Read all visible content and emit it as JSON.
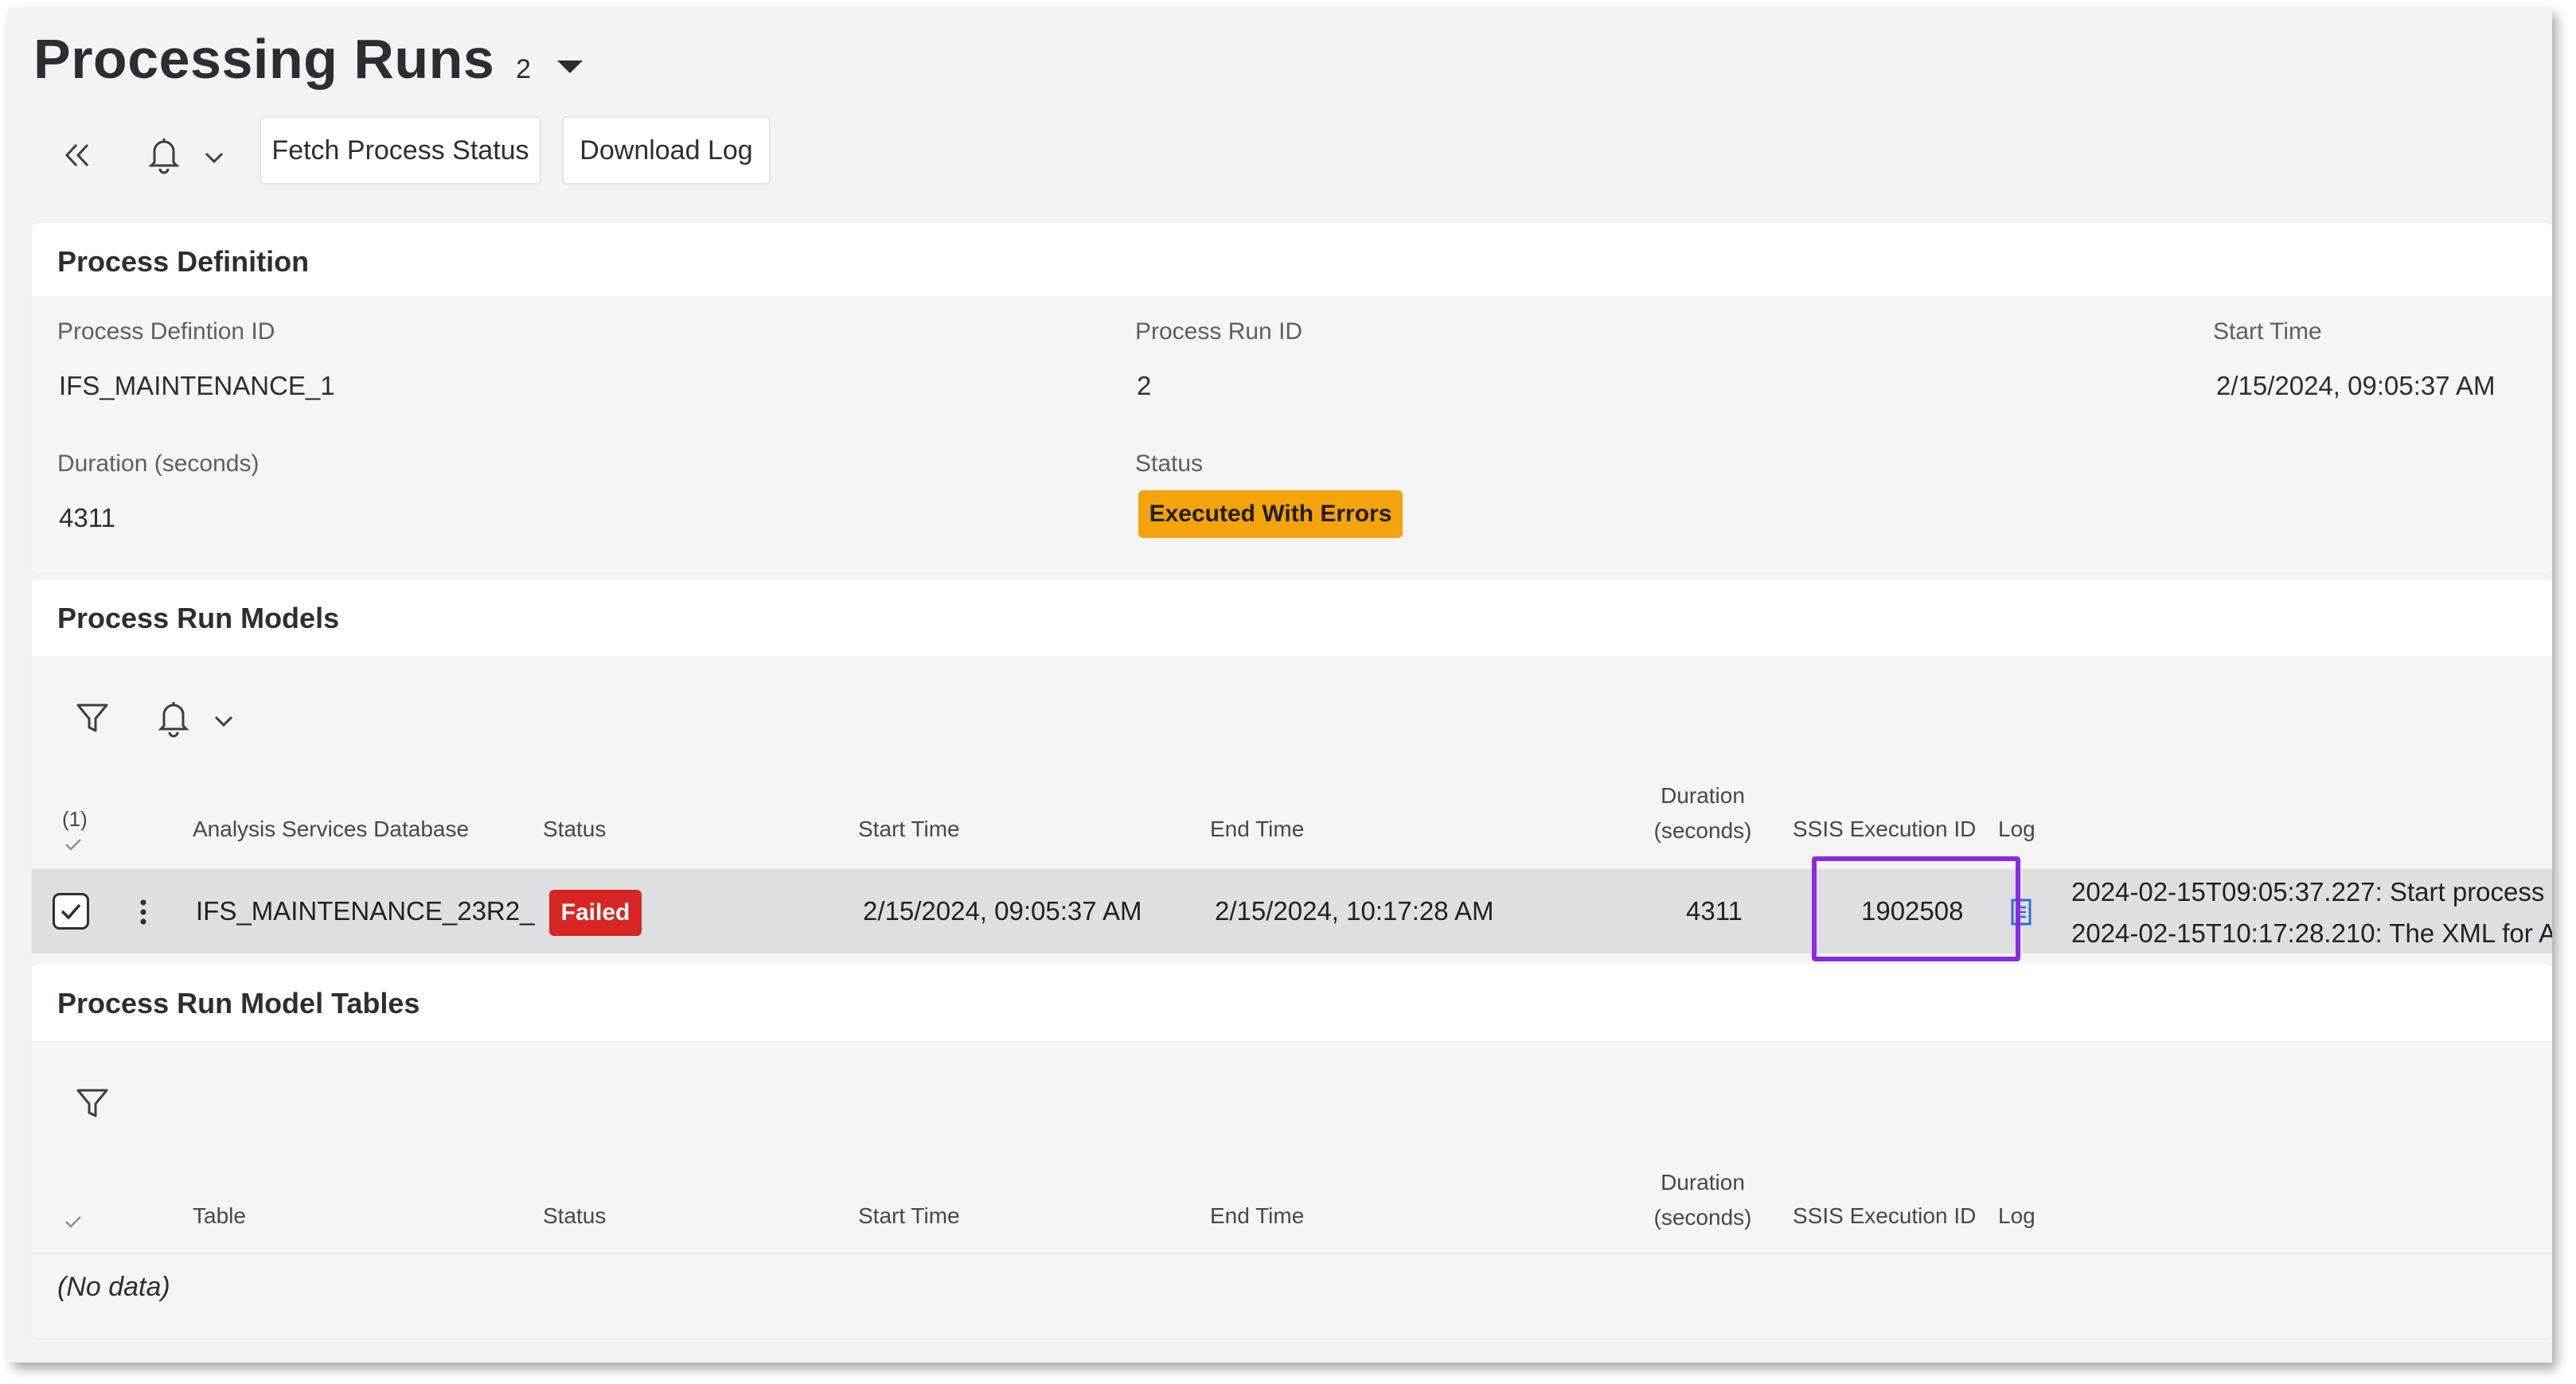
{
  "header": {
    "title": "Processing Runs",
    "count": "2"
  },
  "toolbar": {
    "fetch_label": "Fetch Process Status",
    "download_label": "Download Log"
  },
  "process_definition": {
    "title": "Process Definition",
    "fields": {
      "definition_id": {
        "label": "Process Defintion ID",
        "value": "IFS_MAINTENANCE_1"
      },
      "run_id": {
        "label": "Process Run ID",
        "value": "2"
      },
      "start_time": {
        "label": "Start Time",
        "value": "2/15/2024, 09:05:37 AM"
      },
      "duration": {
        "label": "Duration (seconds)",
        "value": "4311"
      },
      "status": {
        "label": "Status",
        "value": "Executed With Errors",
        "color": "#f5a30a"
      }
    }
  },
  "run_models": {
    "title": "Process Run Models",
    "selection_count": "(1)",
    "columns": {
      "database": "Analysis Services Database",
      "status": "Status",
      "start": "Start Time",
      "end": "End Time",
      "duration_line1": "Duration",
      "duration_line2": "(seconds)",
      "ssis": "SSIS Execution ID",
      "log": "Log"
    },
    "rows": [
      {
        "database": "IFS_MAINTENANCE_23R2_",
        "status": "Failed",
        "status_color": "#d92525",
        "start": "2/15/2024, 09:05:37 AM",
        "end": "2/15/2024, 10:17:28 AM",
        "duration": "4311",
        "ssis_id": "1902508",
        "log_line1": "2024-02-15T09:05:37.227: Start process",
        "log_line2": "2024-02-15T10:17:28.210: The XML for A"
      }
    ],
    "highlight_color": "#8a2be2"
  },
  "run_model_tables": {
    "title": "Process Run Model Tables",
    "columns": {
      "table": "Table",
      "status": "Status",
      "start": "Start Time",
      "end": "End Time",
      "duration_line1": "Duration",
      "duration_line2": "(seconds)",
      "ssis": "SSIS Execution ID",
      "log": "Log"
    },
    "empty_text": "(No data)"
  }
}
